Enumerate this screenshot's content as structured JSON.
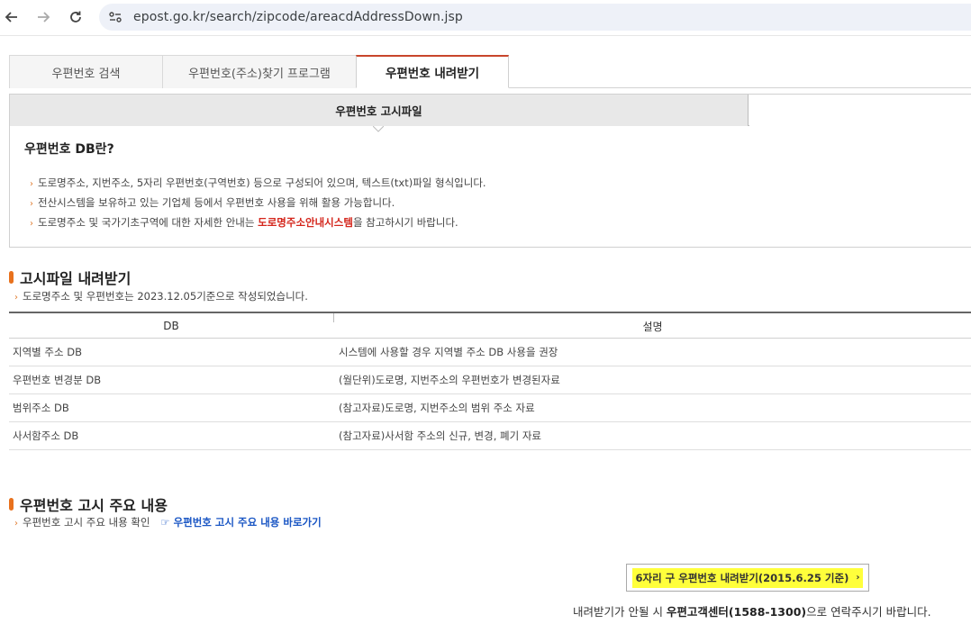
{
  "browser": {
    "url": "epost.go.kr/search/zipcode/areacdAddressDown.jsp"
  },
  "main_tabs": [
    {
      "label": "우편번호 검색"
    },
    {
      "label": "우편번호(주소)찾기 프로그램"
    },
    {
      "label": "우편번호 내려받기"
    }
  ],
  "sub_tabs": [
    {
      "label": "우편번호 고시파일"
    },
    {
      "label": ""
    }
  ],
  "info": {
    "title": "우편번호 DB란?",
    "line1": "도로명주소, 지번주소, 5자리 우편번호(구역번호) 등으로 구성되어 있으며, 텍스트(txt)파일 형식입니다.",
    "line2": "전산시스템을 보유하고 있는 기업체 등에서 우편번호 사용을 위해 활용 가능합니다.",
    "line3_pre": "도로명주소 및 국가기초구역에 대한 자세한 안내는 ",
    "line3_link": "도로명주소안내시스템",
    "line3_post": "을 참고하시기 바랍니다."
  },
  "download_section": {
    "heading": "고시파일 내려받기",
    "note": "도로명주소 및 우편번호는 2023.12.05기준으로 작성되었습니다."
  },
  "table": {
    "headers": [
      "DB",
      "설명"
    ],
    "rows": [
      [
        "지역별 주소 DB",
        "시스템에 사용할 경우 지역별 주소 DB 사용을 권장"
      ],
      [
        "우편번호 변경분 DB",
        "(월단위)도로명, 지번주소의 우편번호가 변경된자료"
      ],
      [
        "범위주소 DB",
        "(참고자료)도로명, 지번주소의 범위 주소 자료"
      ],
      [
        "사서함주소 DB",
        "(참고자료)사서함 주소의 신규, 변경, 폐기 자료"
      ]
    ]
  },
  "notice_section": {
    "heading": "우편번호 고시 주요 내용",
    "note": "우편번호 고시 주요 내용 확인",
    "link": "☞ 우편번호 고시 주요 내용 바로가기"
  },
  "legacy_button": {
    "label": "6자리 구 우편번호 내려받기(2015.6.25 기준)",
    "arrow": "›"
  },
  "contact": {
    "pre": "내려받기가 안될 시 ",
    "bold": "우편고객센터(1588-1300)",
    "post": "으로 연락주시기 바랍니다."
  },
  "colors": {
    "accent_orange": "#e8711d",
    "tab_active_border": "#c8452b",
    "link_red": "#d4261c",
    "link_blue": "#1a56c4",
    "highlight": "#ffff3b"
  },
  "icons": [
    "back-arrow-icon",
    "forward-arrow-icon",
    "reload-icon",
    "site-settings-icon",
    "chevron-right-icon"
  ]
}
